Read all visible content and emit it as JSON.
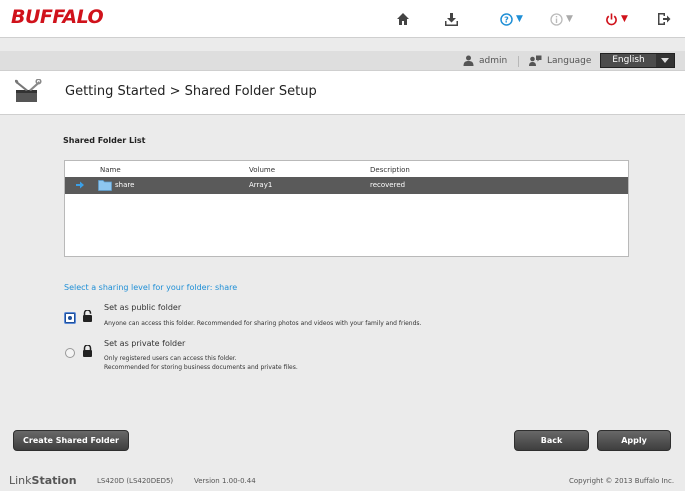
{
  "brand": "BUFFALO",
  "colors": {
    "brand_red": "#d0121b",
    "accent_blue": "#1f8fd6",
    "selected_row": "#5a5a5a"
  },
  "topbar": {
    "icons": [
      "home-icon",
      "download-icon",
      "help-icon",
      "info-icon",
      "power-icon",
      "logout-icon"
    ]
  },
  "userbar": {
    "user": "admin",
    "language_label": "Language",
    "language_value": "English"
  },
  "header": {
    "title": "Getting Started > Shared Folder Setup"
  },
  "shared_folder_list": {
    "title": "Shared Folder List",
    "columns": [
      "Name",
      "Volume",
      "Description"
    ],
    "rows": [
      {
        "name": "share",
        "volume": "Array1",
        "description": "recovered",
        "selected": true
      }
    ]
  },
  "sharing": {
    "prompt": "Select a sharing level for your folder: share",
    "public": {
      "label": "Set as public folder",
      "desc1": "Anyone can access this folder. Recommended for sharing photos and videos with your family and friends.",
      "checked": true
    },
    "private": {
      "label": "Set as private folder",
      "desc1": "Only registered users can access this folder.",
      "desc2": "Recommended for storing business documents and private files.",
      "checked": false
    }
  },
  "buttons": {
    "create": "Create Shared Folder",
    "back": "Back",
    "apply": "Apply"
  },
  "footer": {
    "product_a": "Link",
    "product_b": "Station",
    "model": "LS420D (LS420DED5)",
    "version": "Version 1.00-0.44",
    "copyright": "Copyright © 2013 Buffalo Inc."
  }
}
